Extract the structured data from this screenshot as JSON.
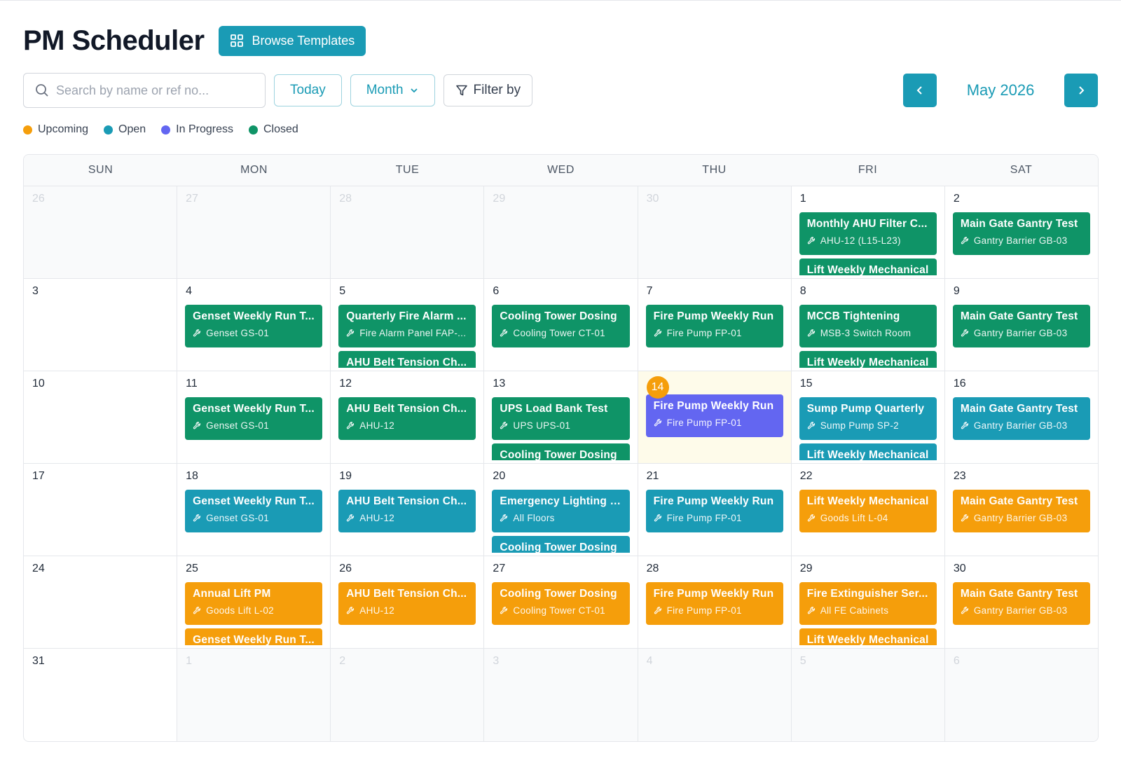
{
  "app": {
    "title": "PM Scheduler",
    "browse_label": "Browse Templates"
  },
  "toolbar": {
    "search_placeholder": "Search by name or ref no...",
    "today_label": "Today",
    "view_label": "Month",
    "filter_label": "Filter by"
  },
  "nav": {
    "month_label": "May 2026"
  },
  "colors": {
    "accent": "#1a9bb5",
    "upcoming": "#f59e0b",
    "open": "#1a9bb5",
    "in_progress": "#6366f1",
    "closed": "#0f9467"
  },
  "legend": [
    {
      "label": "Upcoming",
      "status": "upcoming"
    },
    {
      "label": "Open",
      "status": "open"
    },
    {
      "label": "In Progress",
      "status": "progress"
    },
    {
      "label": "Closed",
      "status": "closed"
    }
  ],
  "weekdays": [
    "SUN",
    "MON",
    "TUE",
    "WED",
    "THU",
    "FRI",
    "SAT"
  ],
  "weeks": [
    [
      {
        "day": "26",
        "out": true,
        "events": []
      },
      {
        "day": "27",
        "out": true,
        "events": []
      },
      {
        "day": "28",
        "out": true,
        "events": []
      },
      {
        "day": "29",
        "out": true,
        "events": []
      },
      {
        "day": "30",
        "out": true,
        "events": []
      },
      {
        "day": "1",
        "events": [
          {
            "title": "Monthly AHU Filter C...",
            "asset": "AHU-12 (L15-L23)",
            "status": "closed"
          },
          {
            "title": "Lift Weekly Mechanical",
            "asset": "",
            "status": "closed"
          }
        ]
      },
      {
        "day": "2",
        "events": [
          {
            "title": "Main Gate Gantry Test",
            "asset": "Gantry Barrier GB-03",
            "status": "closed"
          }
        ]
      }
    ],
    [
      {
        "day": "3",
        "events": []
      },
      {
        "day": "4",
        "events": [
          {
            "title": "Genset Weekly Run T...",
            "asset": "Genset GS-01",
            "status": "closed"
          }
        ]
      },
      {
        "day": "5",
        "events": [
          {
            "title": "Quarterly Fire Alarm ...",
            "asset": "Fire Alarm Panel FAP-...",
            "status": "closed"
          },
          {
            "title": "AHU Belt Tension Ch...",
            "asset": "",
            "status": "closed"
          }
        ]
      },
      {
        "day": "6",
        "events": [
          {
            "title": "Cooling Tower Dosing",
            "asset": "Cooling Tower CT-01",
            "status": "closed"
          }
        ]
      },
      {
        "day": "7",
        "events": [
          {
            "title": "Fire Pump Weekly Run",
            "asset": "Fire Pump FP-01",
            "status": "closed"
          }
        ]
      },
      {
        "day": "8",
        "events": [
          {
            "title": "MCCB Tightening",
            "asset": "MSB-3 Switch Room",
            "status": "closed"
          },
          {
            "title": "Lift Weekly Mechanical",
            "asset": "",
            "status": "closed"
          }
        ]
      },
      {
        "day": "9",
        "events": [
          {
            "title": "Main Gate Gantry Test",
            "asset": "Gantry Barrier GB-03",
            "status": "closed"
          }
        ]
      }
    ],
    [
      {
        "day": "10",
        "events": []
      },
      {
        "day": "11",
        "events": [
          {
            "title": "Genset Weekly Run T...",
            "asset": "Genset GS-01",
            "status": "closed"
          }
        ]
      },
      {
        "day": "12",
        "events": [
          {
            "title": "AHU Belt Tension Ch...",
            "asset": "AHU-12",
            "status": "closed"
          }
        ]
      },
      {
        "day": "13",
        "events": [
          {
            "title": "UPS Load Bank Test",
            "asset": "UPS UPS-01",
            "status": "closed"
          },
          {
            "title": "Cooling Tower Dosing",
            "asset": "",
            "status": "closed"
          }
        ]
      },
      {
        "day": "14",
        "today": true,
        "events": [
          {
            "title": "Fire Pump Weekly Run",
            "asset": "Fire Pump FP-01",
            "status": "progress"
          }
        ]
      },
      {
        "day": "15",
        "events": [
          {
            "title": "Sump Pump Quarterly",
            "asset": "Sump Pump SP-2",
            "status": "open"
          },
          {
            "title": "Lift Weekly Mechanical",
            "asset": "",
            "status": "open"
          }
        ]
      },
      {
        "day": "16",
        "events": [
          {
            "title": "Main Gate Gantry Test",
            "asset": "Gantry Barrier GB-03",
            "status": "open"
          }
        ]
      }
    ],
    [
      {
        "day": "17",
        "events": []
      },
      {
        "day": "18",
        "events": [
          {
            "title": "Genset Weekly Run T...",
            "asset": "Genset GS-01",
            "status": "open"
          }
        ]
      },
      {
        "day": "19",
        "events": [
          {
            "title": "AHU Belt Tension Ch...",
            "asset": "AHU-12",
            "status": "open"
          }
        ]
      },
      {
        "day": "20",
        "events": [
          {
            "title": "Emergency Lighting T...",
            "asset": "All Floors",
            "status": "open"
          },
          {
            "title": "Cooling Tower Dosing",
            "asset": "",
            "status": "open"
          }
        ]
      },
      {
        "day": "21",
        "events": [
          {
            "title": "Fire Pump Weekly Run",
            "asset": "Fire Pump FP-01",
            "status": "open"
          }
        ]
      },
      {
        "day": "22",
        "events": [
          {
            "title": "Lift Weekly Mechanical",
            "asset": "Goods Lift L-04",
            "status": "upcoming"
          }
        ]
      },
      {
        "day": "23",
        "events": [
          {
            "title": "Main Gate Gantry Test",
            "asset": "Gantry Barrier GB-03",
            "status": "upcoming"
          }
        ]
      }
    ],
    [
      {
        "day": "24",
        "events": []
      },
      {
        "day": "25",
        "events": [
          {
            "title": "Annual Lift PM",
            "asset": "Goods Lift L-02",
            "status": "upcoming"
          },
          {
            "title": "Genset Weekly Run T...",
            "asset": "",
            "status": "upcoming"
          }
        ]
      },
      {
        "day": "26",
        "events": [
          {
            "title": "AHU Belt Tension Ch...",
            "asset": "AHU-12",
            "status": "upcoming"
          }
        ]
      },
      {
        "day": "27",
        "events": [
          {
            "title": "Cooling Tower Dosing",
            "asset": "Cooling Tower CT-01",
            "status": "upcoming"
          }
        ]
      },
      {
        "day": "28",
        "events": [
          {
            "title": "Fire Pump Weekly Run",
            "asset": "Fire Pump FP-01",
            "status": "upcoming"
          }
        ]
      },
      {
        "day": "29",
        "events": [
          {
            "title": "Fire Extinguisher Ser...",
            "asset": "All FE Cabinets",
            "status": "upcoming"
          },
          {
            "title": "Lift Weekly Mechanical",
            "asset": "",
            "status": "upcoming"
          }
        ]
      },
      {
        "day": "30",
        "events": [
          {
            "title": "Main Gate Gantry Test",
            "asset": "Gantry Barrier GB-03",
            "status": "upcoming"
          }
        ]
      }
    ],
    [
      {
        "day": "31",
        "events": []
      },
      {
        "day": "1",
        "out": true,
        "events": []
      },
      {
        "day": "2",
        "out": true,
        "events": []
      },
      {
        "day": "3",
        "out": true,
        "events": []
      },
      {
        "day": "4",
        "out": true,
        "events": []
      },
      {
        "day": "5",
        "out": true,
        "events": []
      },
      {
        "day": "6",
        "out": true,
        "events": []
      }
    ]
  ]
}
